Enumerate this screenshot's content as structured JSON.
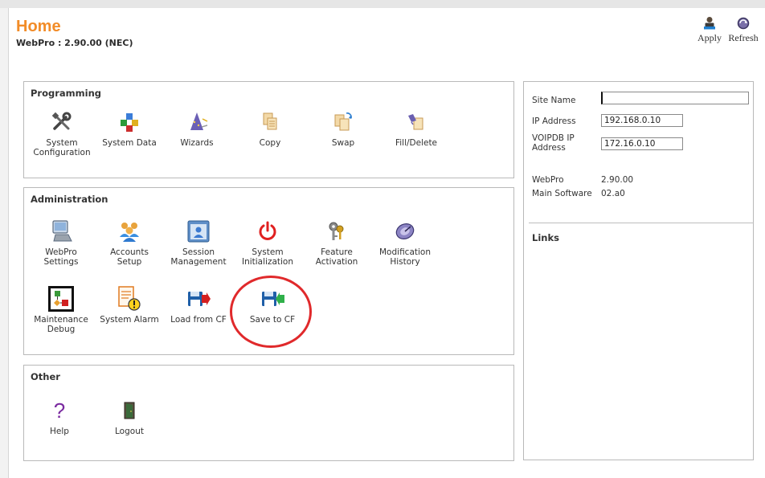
{
  "header": {
    "title": "Home",
    "subtitle": "WebPro : 2.90.00 (NEC)"
  },
  "toolbar": {
    "apply_label": "Apply",
    "refresh_label": "Refresh",
    "apply_icon": "apply-user-icon",
    "refresh_icon": "refresh-icon"
  },
  "programming": {
    "title": "Programming",
    "items": [
      {
        "label": "System\nConfiguration",
        "icon": "tools-icon"
      },
      {
        "label": "System Data",
        "icon": "blocks-icon"
      },
      {
        "label": "Wizards",
        "icon": "wizard-icon"
      },
      {
        "label": "Copy",
        "icon": "copy-icon"
      },
      {
        "label": "Swap",
        "icon": "swap-icon"
      },
      {
        "label": "Fill/Delete",
        "icon": "fill-delete-icon"
      }
    ]
  },
  "administration": {
    "title": "Administration",
    "items": [
      {
        "label": "WebPro\nSettings",
        "icon": "computer-icon"
      },
      {
        "label": "Accounts\nSetup",
        "icon": "users-icon"
      },
      {
        "label": "Session\nManagement",
        "icon": "session-icon"
      },
      {
        "label": "System\nInitialization",
        "icon": "power-icon"
      },
      {
        "label": "Feature\nActivation",
        "icon": "keys-icon"
      },
      {
        "label": "Modification\nHistory",
        "icon": "history-icon"
      },
      {
        "label": "Maintenance\nDebug",
        "icon": "debug-icon"
      },
      {
        "label": "System Alarm",
        "icon": "alarm-icon"
      },
      {
        "label": "Load from CF",
        "icon": "load-cf-icon"
      },
      {
        "label": "Save to CF",
        "icon": "save-cf-icon"
      }
    ]
  },
  "other": {
    "title": "Other",
    "items": [
      {
        "label": "Help",
        "icon": "help-icon"
      },
      {
        "label": "Logout",
        "icon": "logout-icon"
      }
    ]
  },
  "site_info": {
    "site_name_label": "Site Name",
    "site_name_value": "",
    "ip_label": "IP Address",
    "ip_value": "192.168.0.10",
    "voipdb_label": "VOIPDB IP\nAddress",
    "voipdb_value": "172.16.0.10",
    "webpro_label": "WebPro",
    "webpro_value": "2.90.00",
    "main_software_label": "Main Software",
    "main_software_value": "02.a0",
    "links_title": "Links"
  },
  "colors": {
    "title_orange": "#f28c28",
    "highlight_red": "#e0292b",
    "border_gray": "#b9b9b9"
  }
}
